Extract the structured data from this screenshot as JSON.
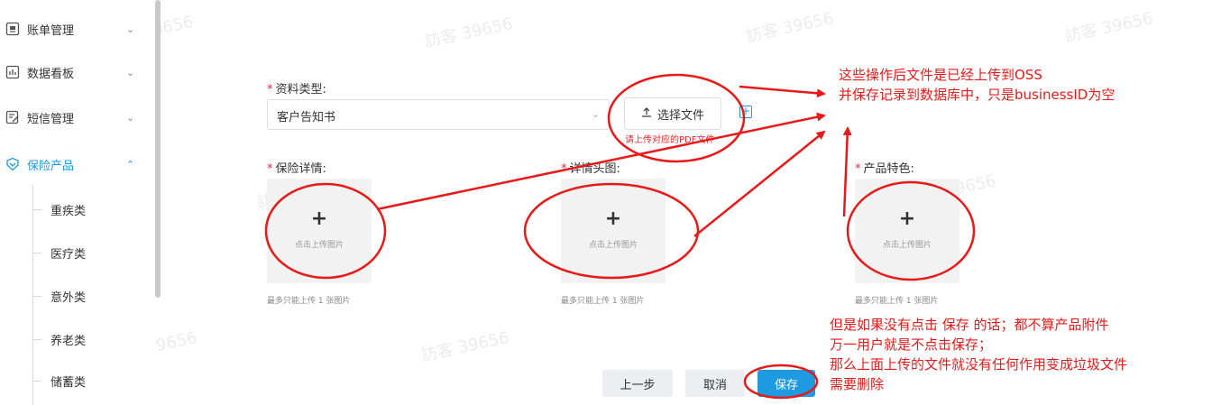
{
  "sidebar": {
    "menu": [
      {
        "label": "账单管理",
        "icon": "bill-icon",
        "caret": "⌄"
      },
      {
        "label": "数据看板",
        "icon": "chart-icon",
        "caret": "⌄"
      },
      {
        "label": "短信管理",
        "icon": "sms-icon",
        "caret": "⌄"
      },
      {
        "label": "保险产品",
        "icon": "shield-icon",
        "caret": "⌃",
        "active": true
      }
    ],
    "sub_items": [
      "重疾类",
      "医疗类",
      "意外类",
      "养老类",
      "储蓄类"
    ]
  },
  "form": {
    "doc_type_label": "资料类型:",
    "doc_type_value": "客户告知书",
    "select_file_label": "选择文件",
    "file_tip": "请上传对应的PDF文件",
    "plus": "+",
    "uploads": [
      {
        "label": "保险详情:",
        "button_text": "点击上传图片",
        "hint": "最多只能上传 1 张图片"
      },
      {
        "label": "详情头图:",
        "button_text": "点击上传图片",
        "hint": "最多只能上传 1 张图片"
      },
      {
        "label": "产品特色:",
        "button_text": "点击上传图片",
        "hint": "最多只能上传 1 张图片"
      }
    ],
    "required_mark": "*"
  },
  "buttons": {
    "prev": "上一步",
    "cancel": "取消",
    "save": "保存"
  },
  "annotations": {
    "top_note": [
      "这些操作后文件是已经上传到OSS",
      "并保存记录到数据库中，只是businessID为空"
    ],
    "bottom_note": [
      "但是如果没有点击 保存 的话；都不算产品附件",
      "万一用户就是不点击保存；",
      "那么上面上传的文件就没有任何作用变成垃圾文件",
      "需要删除"
    ]
  },
  "watermark": "訪客 39656",
  "colors": {
    "accent": "#1e9be0",
    "annotation": "#e81919",
    "required": "#f5222d"
  }
}
